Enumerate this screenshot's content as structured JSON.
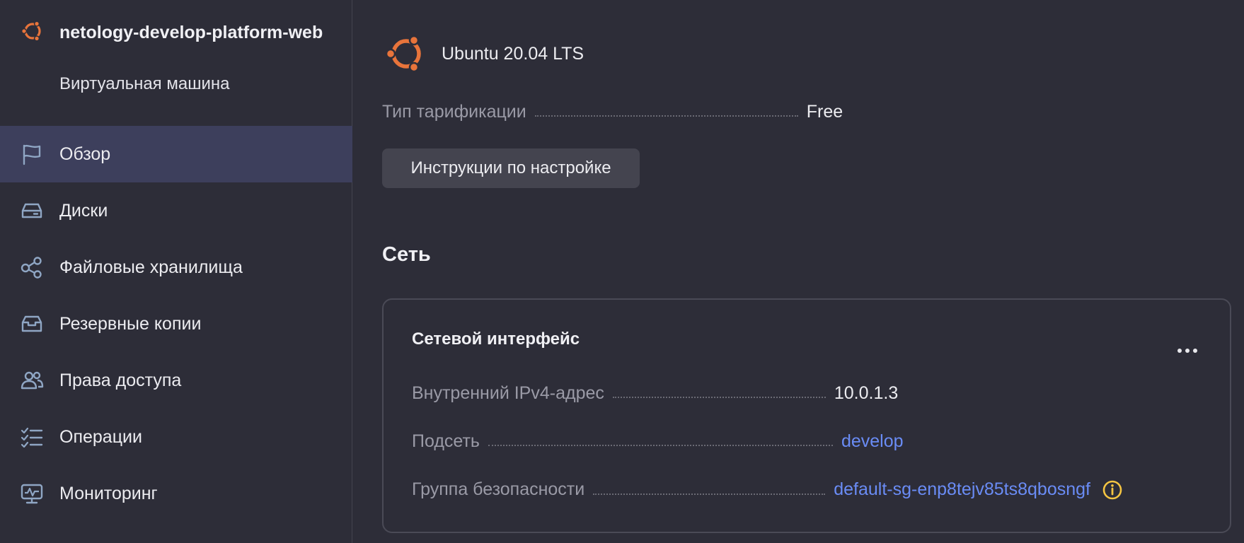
{
  "vm": {
    "name": "netology-develop-platform-web",
    "type": "Виртуальная машина"
  },
  "nav": [
    {
      "label": "Обзор",
      "icon": "flag-icon",
      "active": true
    },
    {
      "label": "Диски",
      "icon": "disk-icon",
      "active": false
    },
    {
      "label": "Файловые хранилища",
      "icon": "share-icon",
      "active": false
    },
    {
      "label": "Резервные копии",
      "icon": "backup-icon",
      "active": false
    },
    {
      "label": "Права доступа",
      "icon": "users-icon",
      "active": false
    },
    {
      "label": "Операции",
      "icon": "checklist-icon",
      "active": false
    },
    {
      "label": "Мониторинг",
      "icon": "monitor-icon",
      "active": false
    }
  ],
  "os": {
    "name": "Ubuntu 20.04 LTS",
    "icon": "ubuntu-logo"
  },
  "billing": {
    "key": "Тип тарификации",
    "value": "Free"
  },
  "setup_button": "Инструкции по настройке",
  "network": {
    "title": "Сеть",
    "card_title": "Сетевой интерфейс",
    "ipv4_key": "Внутренний IPv4-адрес",
    "ipv4_value": "10.0.1.3",
    "subnet_key": "Подсеть",
    "subnet_value": "develop",
    "sg_key": "Группа безопасности",
    "sg_value": "default-sg-enp8tejv85ts8qbosngf"
  },
  "colors": {
    "accent_link": "#6a8cf5",
    "ubuntu_orange": "#e8743b",
    "active_nav_bg": "#3d3f5c",
    "warning_icon": "#f5c542"
  }
}
